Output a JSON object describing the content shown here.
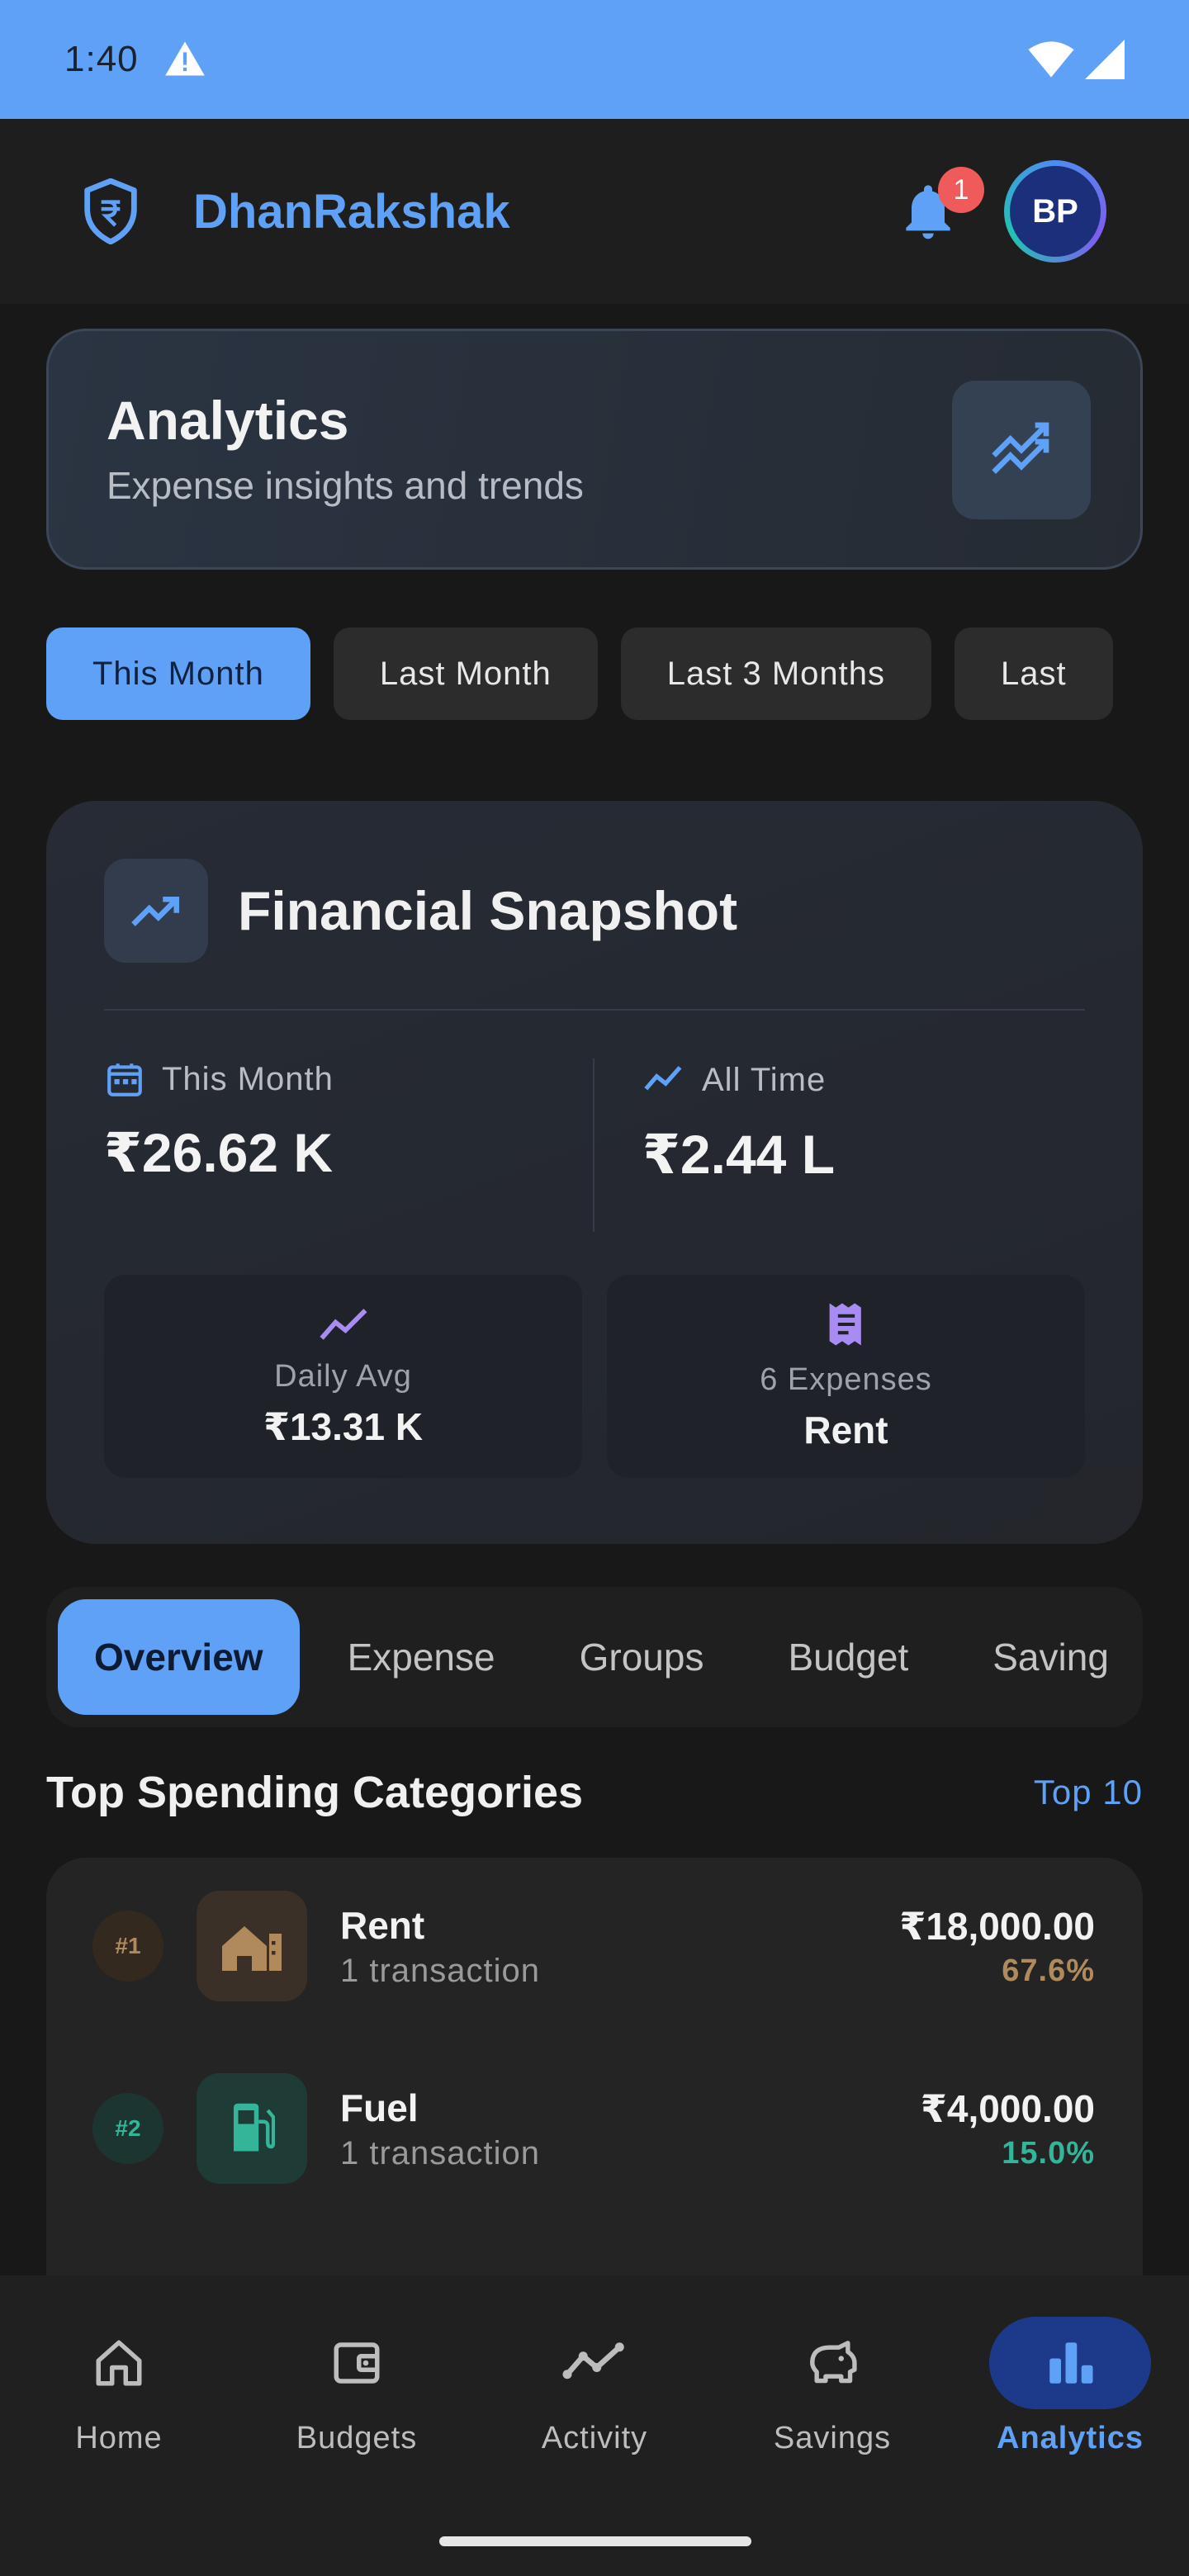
{
  "status_bar": {
    "time": "1:40",
    "icons": [
      "warning-icon",
      "wifi-icon",
      "cellular-icon"
    ]
  },
  "app": {
    "name": "DhanRakshak",
    "notifications_count": "1",
    "avatar_initials": "BP"
  },
  "page_header": {
    "title": "Analytics",
    "subtitle": "Expense insights and trends"
  },
  "period_tabs": [
    "This Month",
    "Last Month",
    "Last 3 Months",
    "Last"
  ],
  "snapshot": {
    "title": "Financial Snapshot",
    "this_month_label": "This Month",
    "this_month_value": "₹26.62 K",
    "all_time_label": "All Time",
    "all_time_value": "₹2.44 L",
    "daily_avg_label": "Daily Avg",
    "daily_avg_value": "₹13.31 K",
    "expenses_label": "6 Expenses",
    "expenses_value": "Rent"
  },
  "section_tabs": [
    "Overview",
    "Expense",
    "Groups",
    "Budget",
    "Saving"
  ],
  "top_categories": {
    "title": "Top Spending Categories",
    "action": "Top 10",
    "items": [
      {
        "rank": "#1",
        "name": "Rent",
        "count": "1 transaction",
        "amount": "₹18,000.00",
        "percent": "67.6%",
        "color": "#b08a5c"
      },
      {
        "rank": "#2",
        "name": "Fuel",
        "count": "1 transaction",
        "amount": "₹4,000.00",
        "percent": "15.0%",
        "color": "#34b59a"
      }
    ]
  },
  "bottom_nav": [
    "Home",
    "Budgets",
    "Activity",
    "Savings",
    "Analytics"
  ],
  "colors": {
    "accent": "#5fa1f6",
    "background": "#181818",
    "active_nav": "#1d3a8a"
  }
}
